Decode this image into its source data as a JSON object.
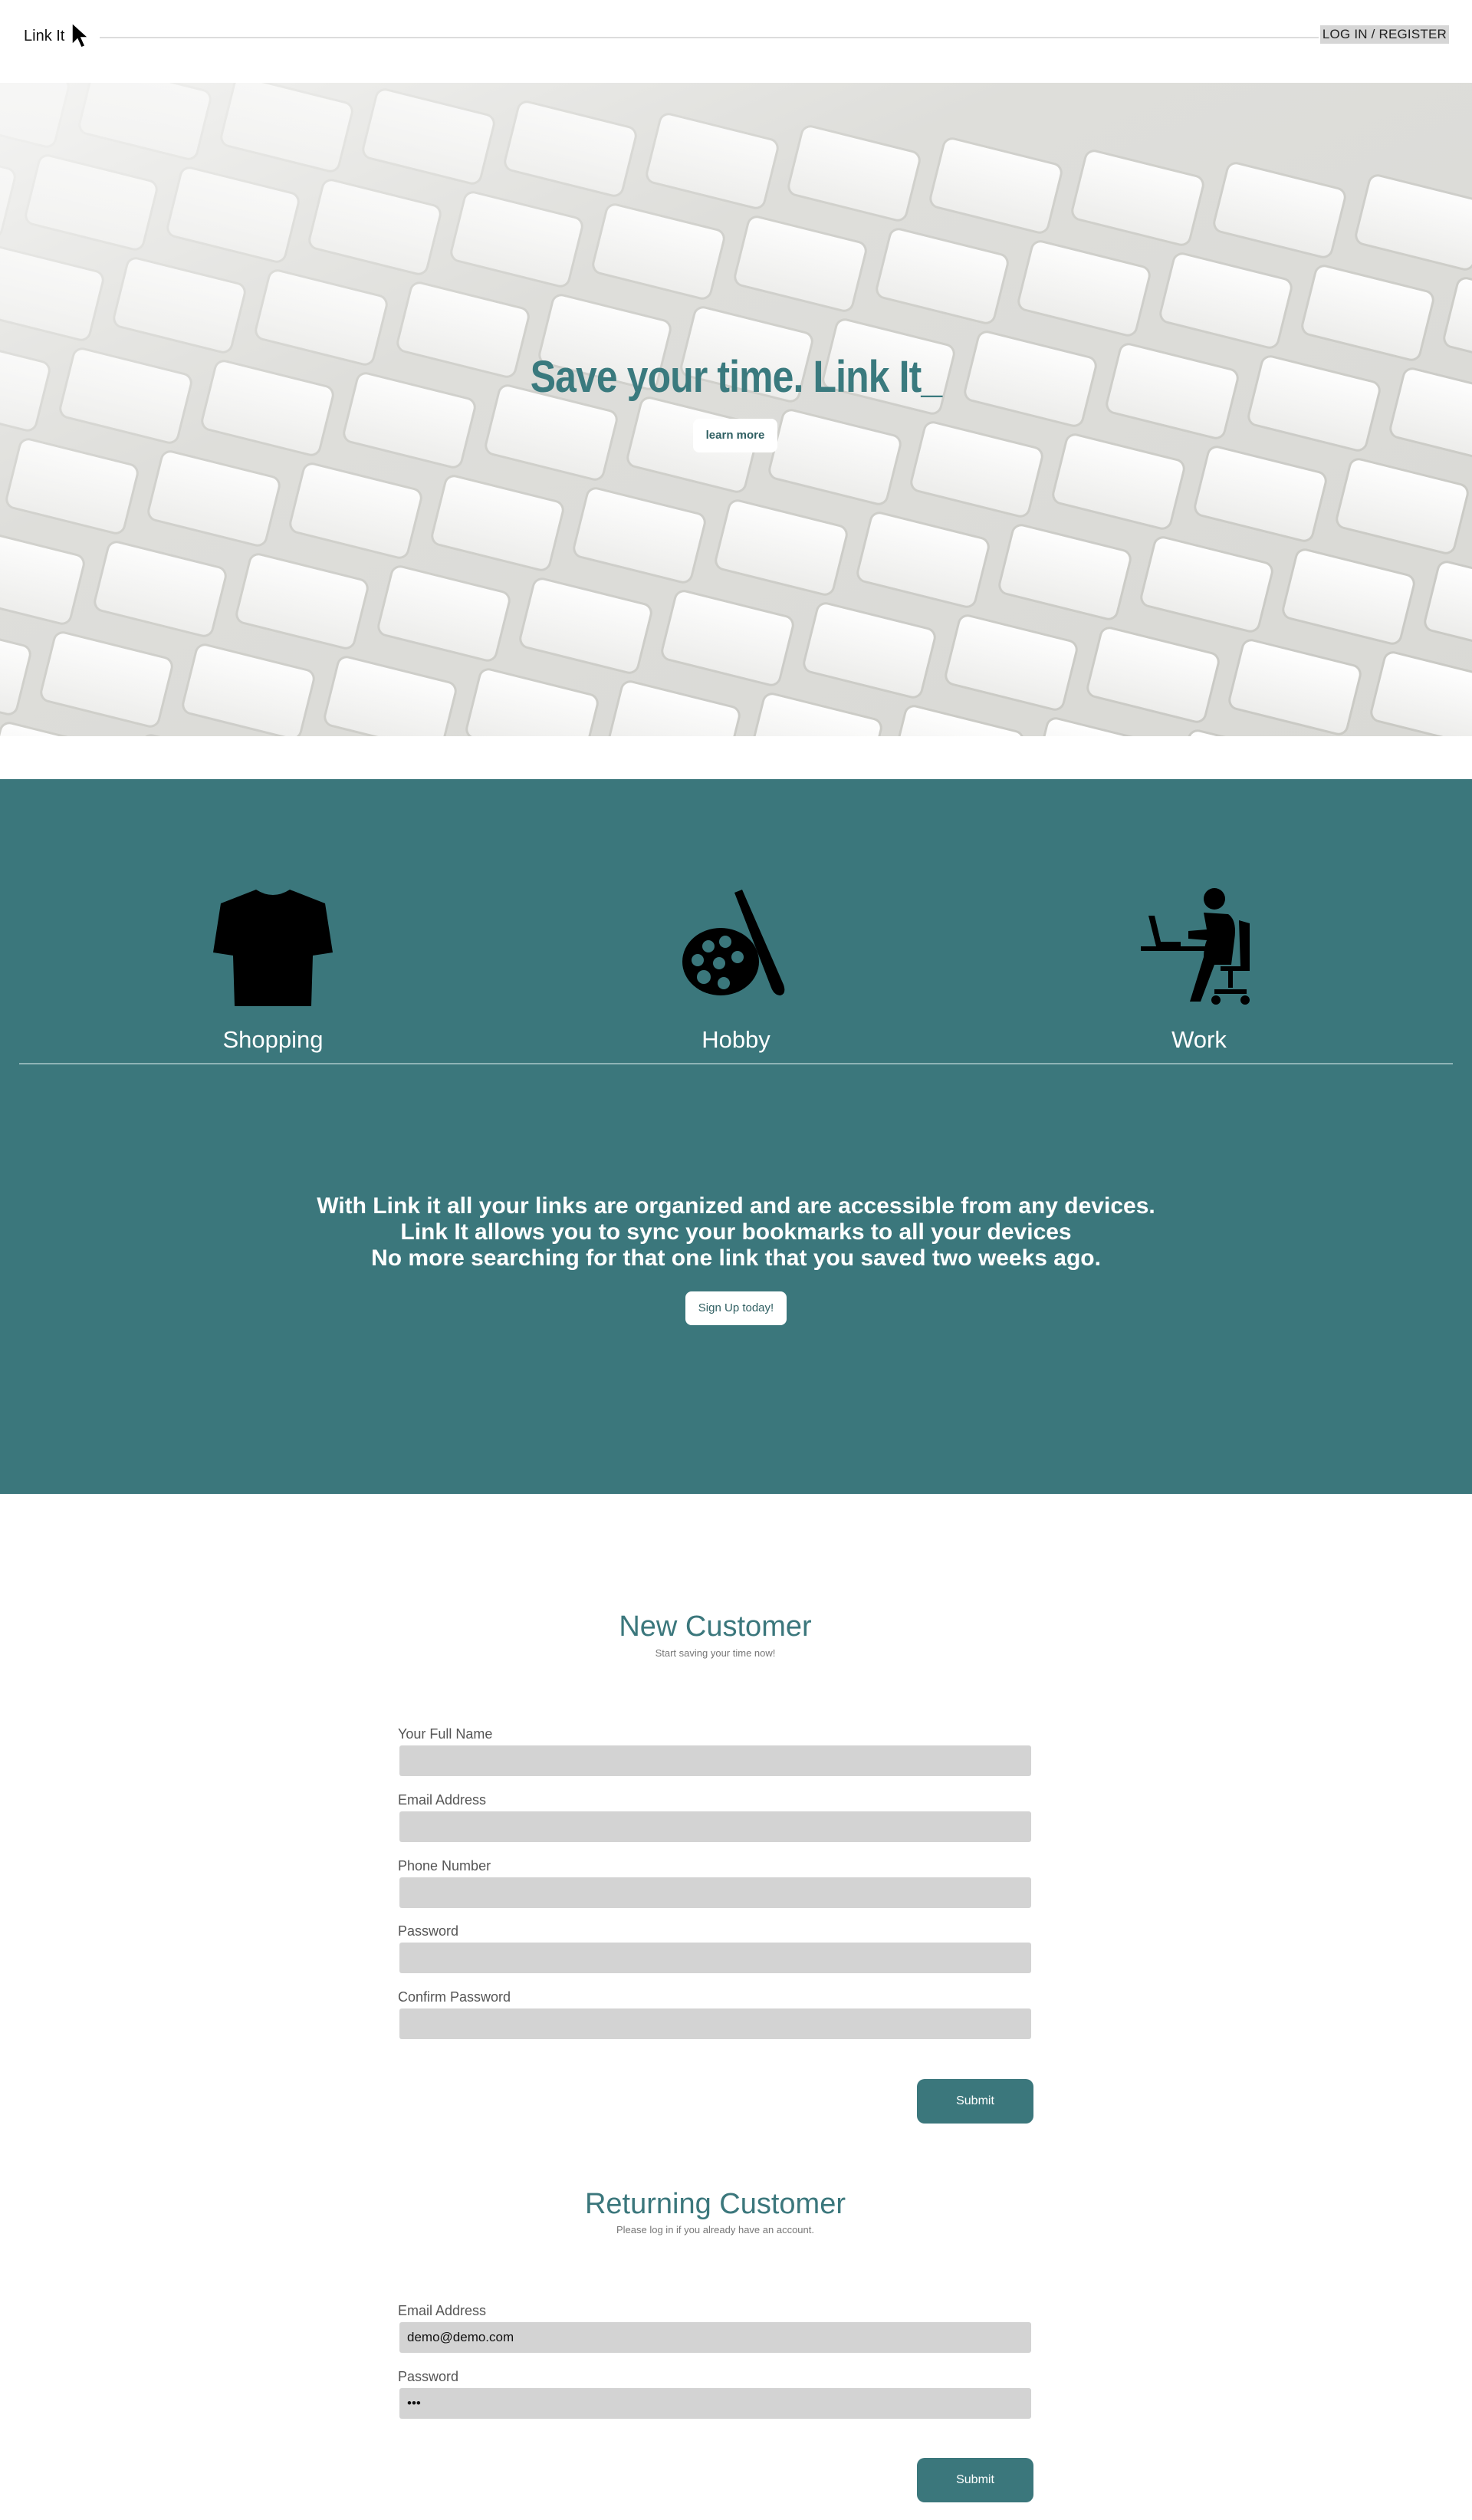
{
  "header": {
    "brand": "Link It",
    "login_label": "LOG IN / REGISTER"
  },
  "hero": {
    "title": "Save your time. Link It_",
    "learn_more_label": "learn more"
  },
  "features": {
    "items": [
      {
        "label": "Shopping",
        "icon": "tshirt-icon"
      },
      {
        "label": "Hobby",
        "icon": "palette-icon"
      },
      {
        "label": "Work",
        "icon": "person-at-desk-icon"
      }
    ],
    "text_lines": [
      "With Link it all your links are organized and are accessible from any devices.",
      "Link It allows you to sync your bookmarks to all your devices",
      "No more searching for that one link that you saved two weeks ago."
    ],
    "signup_label": "Sign Up today!"
  },
  "new_customer": {
    "title": "New Customer",
    "subtitle": "Start saving your time now!",
    "fields": [
      {
        "label": "Your Full Name",
        "value": ""
      },
      {
        "label": "Email Address",
        "value": ""
      },
      {
        "label": "Phone Number",
        "value": ""
      },
      {
        "label": "Password",
        "value": ""
      },
      {
        "label": "Confirm Password",
        "value": ""
      }
    ],
    "submit_label": "Submit"
  },
  "returning_customer": {
    "title": "Returning Customer",
    "subtitle": "Please log in if you already have an account.",
    "fields": [
      {
        "label": "Email Address",
        "value": "demo@demo.com"
      },
      {
        "label": "Password",
        "value": "•••"
      }
    ],
    "submit_label": "Submit"
  },
  "colors": {
    "accent": "#3b777c",
    "input_bg": "#d3d3d3"
  }
}
